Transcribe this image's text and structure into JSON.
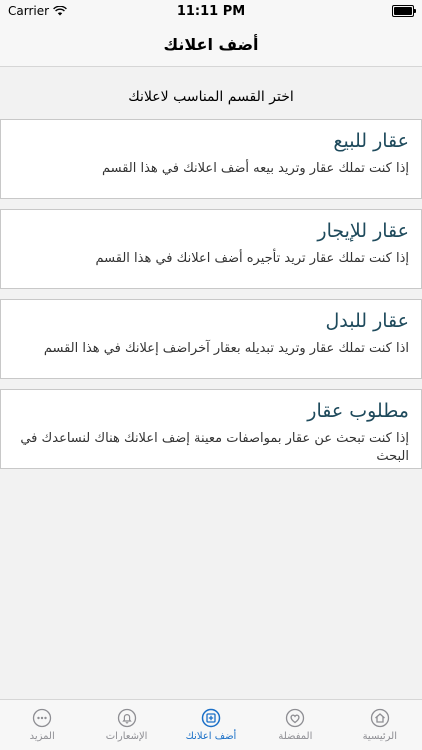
{
  "status": {
    "carrier": "Carrier",
    "time": "11:11 PM"
  },
  "nav": {
    "title": "أضف اعلانك"
  },
  "prompt": "اختر القسم المناسب لاعلانك",
  "cards": [
    {
      "title": "عقار للبيع",
      "desc": "إذا كنت تملك عقار وتريد بيعه أضف اعلانك في هذا القسم"
    },
    {
      "title": "عقار للإيجار",
      "desc": "إذا كنت تملك عقار تريد تأجيره أضف اعلانك في هذا القسم"
    },
    {
      "title": "عقار للبدل",
      "desc": "اذا كنت تملك عقار وتريد تبديله بعقار آخراضف إعلانك في هذا القسم"
    },
    {
      "title": "مطلوب عقار",
      "desc": "إذا كنت تبحث عن عقار بمواصفات معينة إضف اعلانك هناك لنساعدك في البحث"
    }
  ],
  "tabs": [
    {
      "label": "الرئيسية",
      "icon": "home-icon"
    },
    {
      "label": "المفضلة",
      "icon": "heart-icon"
    },
    {
      "label": "أضف اعلانك",
      "icon": "add-ad-icon"
    },
    {
      "label": "الإشعارات",
      "icon": "bell-icon"
    },
    {
      "label": "المزيد",
      "icon": "more-icon"
    }
  ],
  "colors": {
    "accent": "#1a6fc7",
    "card_title": "#1e4a5c"
  }
}
